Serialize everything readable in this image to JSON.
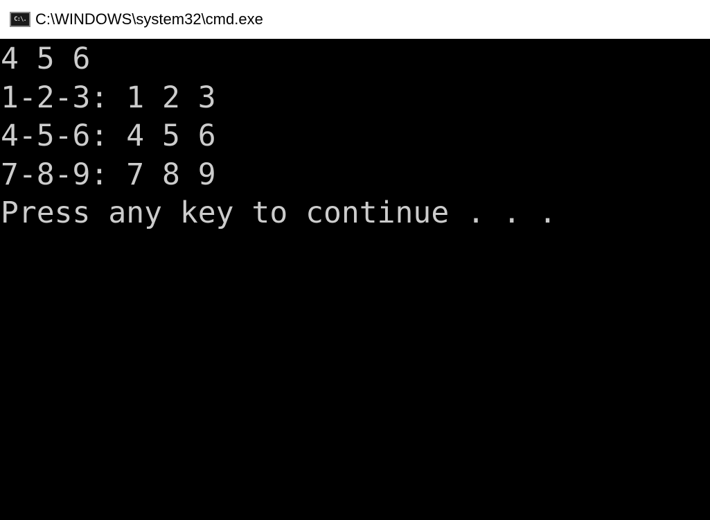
{
  "window": {
    "title": "C:\\WINDOWS\\system32\\cmd.exe",
    "icon": "cmd-icon",
    "icon_text": "C:\\."
  },
  "console": {
    "lines": [
      "4 5 6",
      "1-2-3: 1 2 3",
      "4-5-6: 4 5 6",
      "7-8-9: 7 8 9",
      "Press any key to continue . . ."
    ],
    "background": "#000000",
    "foreground": "#cccccc"
  }
}
